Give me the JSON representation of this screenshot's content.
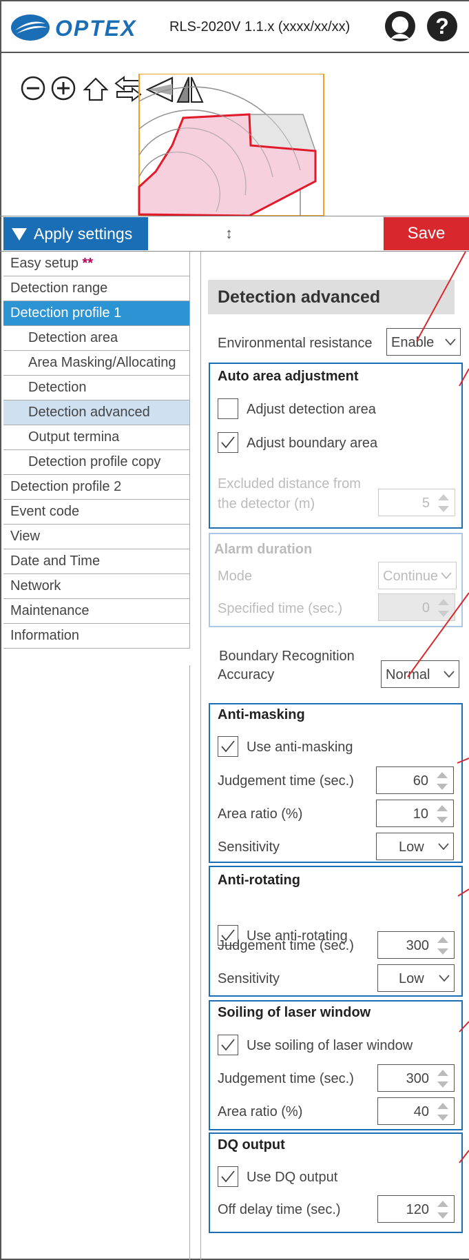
{
  "header": {
    "logo": "OPTEX",
    "version": "RLS-2020V 1.1.x (xxxx/xx/xx)",
    "icons": [
      "user-icon",
      "help-icon"
    ]
  },
  "toolbar": {
    "icons": [
      "zoom-out-icon",
      "zoom-in-icon",
      "home-icon",
      "swap-arrows-icon",
      "triangle-left-icon",
      "mirror-icon"
    ]
  },
  "apply": {
    "label": "Apply settings",
    "resize_glyph": "↕",
    "save": "Save"
  },
  "sidebar": {
    "items": [
      {
        "label": "Easy setup",
        "badge": "**"
      },
      {
        "label": "Detection range"
      },
      {
        "label": "Detection profile 1",
        "active": true
      },
      {
        "label": "Detection area",
        "sub": true
      },
      {
        "label": "Area Masking/Allocating",
        "sub": true
      },
      {
        "label": "Detection",
        "sub": true
      },
      {
        "label": "Detection advanced",
        "sub": true,
        "current": true
      },
      {
        "label": "Output termina",
        "sub": true
      },
      {
        "label": "Detection profile copy",
        "sub": true
      },
      {
        "label": "Detection profile 2"
      },
      {
        "label": "Event code"
      },
      {
        "label": "View"
      },
      {
        "label": "Date and Time"
      },
      {
        "label": "Network"
      },
      {
        "label": "Maintenance"
      },
      {
        "label": "Information"
      }
    ]
  },
  "content": {
    "title": "Detection advanced",
    "env_resistance": {
      "label": "Environmental resistance",
      "value": "Enable"
    },
    "auto_area": {
      "title": "Auto area adjustment",
      "adjust_detection": {
        "label": "Adjust detection area",
        "checked": false
      },
      "adjust_boundary": {
        "label": "Adjust boundary area",
        "checked": true
      },
      "excluded_label_1": "Excluded distance from",
      "excluded_label_2": "the detector (m)",
      "excluded_value": "5"
    },
    "alarm": {
      "title": "Alarm duration",
      "mode_label": "Mode",
      "mode_value": "Continue",
      "time_label": "Specified time (sec.)",
      "time_value": "0"
    },
    "boundary": {
      "label_1": "Boundary Recognition",
      "label_2": "Accuracy",
      "value": "Normal"
    },
    "anti_masking": {
      "title": "Anti-masking",
      "use_label": "Use anti-masking",
      "checked": true,
      "judgement_label": "Judgement time (sec.)",
      "judgement_value": "60",
      "area_label": "Area ratio (%)",
      "area_value": "10",
      "sensitivity_label": "Sensitivity",
      "sensitivity_value": "Low"
    },
    "anti_rotating": {
      "title": "Anti-rotating",
      "use_label": "Use anti-rotating",
      "checked": true,
      "judgement_label": "Judgement time (sec.)",
      "judgement_value": "300",
      "sensitivity_label": "Sensitivity",
      "sensitivity_value": "Low"
    },
    "soiling": {
      "title": "Soiling of laser window",
      "use_label": "Use soiling of laser window",
      "checked": true,
      "judgement_label": "Judgement time (sec.)",
      "judgement_value": "300",
      "area_label": "Area ratio (%)",
      "area_value": "40"
    },
    "dq": {
      "title": "DQ output",
      "use_label": "Use DQ output",
      "checked": true,
      "delay_label": "Off delay time (sec.)",
      "delay_value": "120"
    }
  },
  "colors": {
    "brand": "#1a6eb5",
    "save": "#d9282d",
    "active_nav": "#2d94d3",
    "current_nav": "#cfe0f0",
    "zone_fill": "#f7d0de",
    "zone_stroke": "#e01a2a",
    "orange": "#f0a020"
  }
}
